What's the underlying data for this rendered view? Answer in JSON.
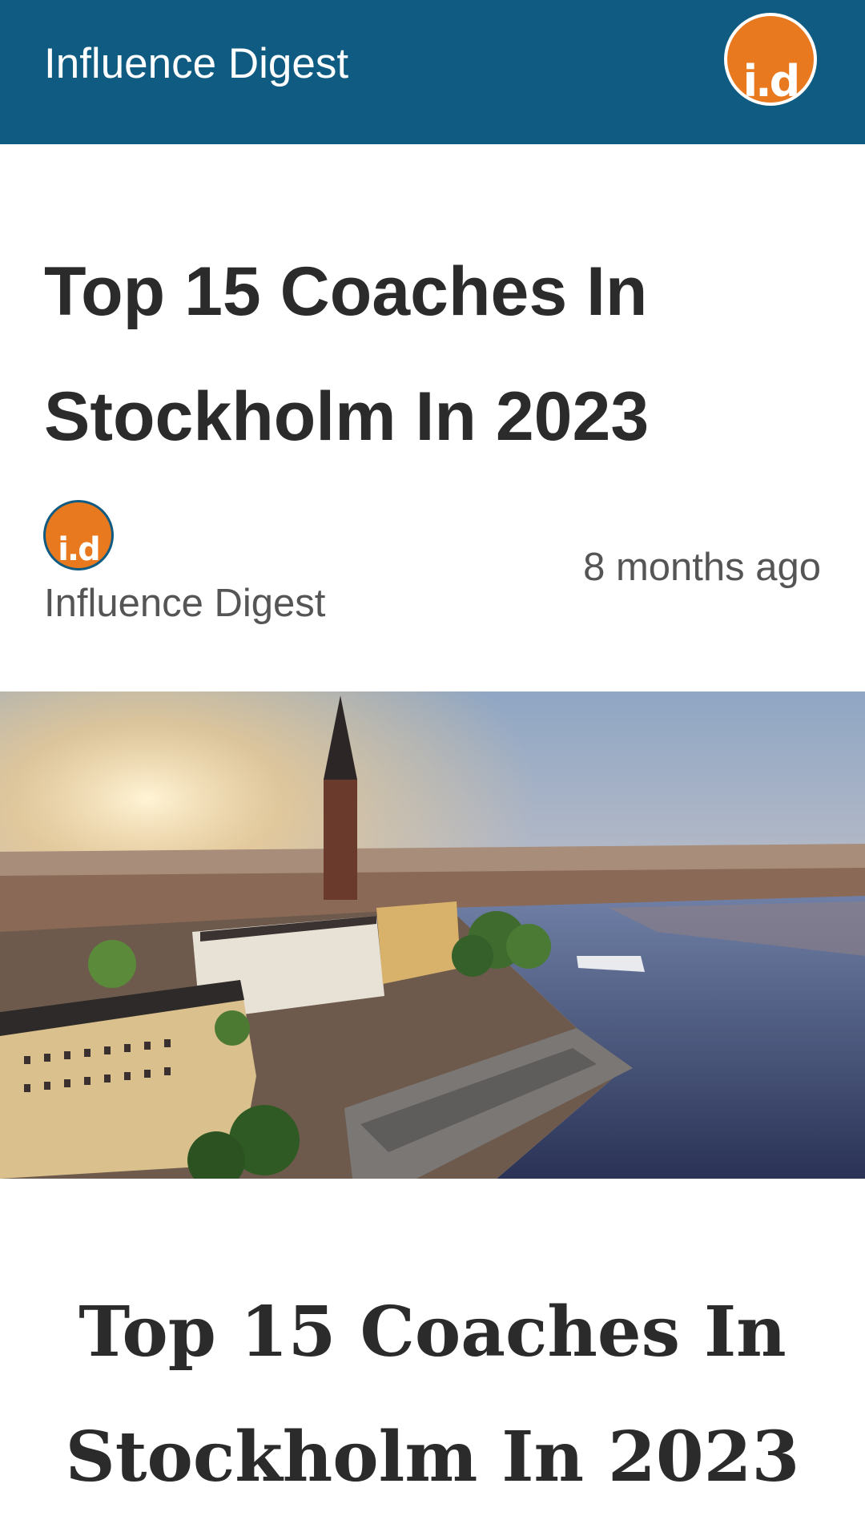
{
  "header": {
    "app_title": "Influence Digest",
    "logo_text": "i.d"
  },
  "article": {
    "title": "Top 15 Coaches In Stockholm In 2023",
    "author": {
      "name": "Influence Digest",
      "logo_text": "i.d"
    },
    "published": "8 months ago",
    "hero_image": {
      "subject": "aerial view of Stockholm at sunset"
    },
    "body_heading": "Top 15 Coaches In Stockholm In 2023"
  },
  "colors": {
    "header_bg": "#0f5b82",
    "logo_bg": "#e8791f",
    "text_dark": "#2b2b2b",
    "text_muted": "#555555"
  }
}
